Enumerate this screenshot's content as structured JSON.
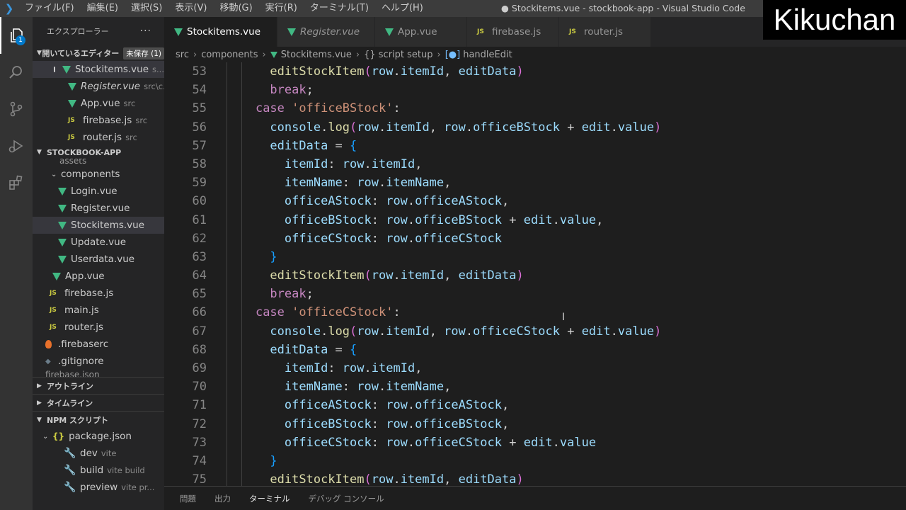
{
  "titlebar": {
    "menu": [
      "ファイル(F)",
      "編集(E)",
      "選択(S)",
      "表示(V)",
      "移動(G)",
      "実行(R)",
      "ターミナル(T)",
      "ヘルプ(H)"
    ],
    "window_title": "● Stockitems.vue - stockbook-app - Visual Studio Code",
    "watermark": "Kikuchan"
  },
  "activity": {
    "explorer_badge": "1"
  },
  "sidebar": {
    "title": "エクスプローラー",
    "more": "···",
    "open_editors": {
      "label": "開いているエディター",
      "unsaved": "未保存 (1)",
      "items": [
        {
          "name": "Stockitems.vue",
          "path": "s..."
        },
        {
          "name": "Register.vue",
          "path": "src\\c..."
        },
        {
          "name": "App.vue",
          "path": "src"
        },
        {
          "name": "firebase.js",
          "path": "src"
        },
        {
          "name": "router.js",
          "path": "src"
        }
      ]
    },
    "project": {
      "label": "STOCKBOOK-APP",
      "items": [
        "assets",
        "components",
        "Login.vue",
        "Register.vue",
        "Stockitems.vue",
        "Update.vue",
        "Userdata.vue",
        "App.vue",
        "firebase.js",
        "main.js",
        "router.js",
        ".firebaserc",
        ".gitignore",
        "firebase.json"
      ]
    },
    "outline": "アウトライン",
    "timeline": "タイムライン",
    "npm": {
      "label": "NPM スクリプト",
      "package": "package.json",
      "scripts": [
        {
          "name": "dev",
          "cmd": "vite"
        },
        {
          "name": "build",
          "cmd": "vite build"
        },
        {
          "name": "preview",
          "cmd": "vite pr..."
        }
      ]
    }
  },
  "tabs": [
    "Stockitems.vue",
    "Register.vue",
    "App.vue",
    "firebase.js",
    "router.js"
  ],
  "breadcrumb": [
    "src",
    "components",
    "Stockitems.vue",
    "{} script setup",
    "handleEdit"
  ],
  "editor": {
    "line_numbers": [
      "53",
      "54",
      "55",
      "56",
      "57",
      "58",
      "59",
      "60",
      "61",
      "62",
      "63",
      "64",
      "65",
      "66",
      "67",
      "68",
      "69",
      "70",
      "71",
      "72",
      "73",
      "74",
      "75"
    ],
    "lines": {
      "l53": {
        "fn": "editStockItem",
        "a": "row",
        "b": "itemId",
        "c": "editData"
      },
      "l54": "break",
      "l55": {
        "kw": "case",
        "str": "'officeBStock'"
      },
      "l56": {
        "obj": "console",
        "fn": "log",
        "a": "row",
        "b": "itemId",
        "c": "row",
        "d": "officeBStock",
        "e": "edit",
        "f": "value"
      },
      "l57": {
        "v": "editData"
      },
      "l58": {
        "k": "itemId",
        "o": "row",
        "p": "itemId"
      },
      "l59": {
        "k": "itemName",
        "o": "row",
        "p": "itemName"
      },
      "l60": {
        "k": "officeAStock",
        "o": "row",
        "p": "officeAStock"
      },
      "l61": {
        "k": "officeBStock",
        "o": "row",
        "p": "officeBStock",
        "e": "edit",
        "f": "value"
      },
      "l62": {
        "k": "officeCStock",
        "o": "row",
        "p": "officeCStock"
      },
      "l64": {
        "fn": "editStockItem",
        "a": "row",
        "b": "itemId",
        "c": "editData"
      },
      "l65": "break",
      "l66": {
        "kw": "case",
        "str": "'officeCStock'"
      },
      "l67": {
        "obj": "console",
        "fn": "log",
        "a": "row",
        "b": "itemId",
        "c": "row",
        "d": "officeCStock",
        "e": "edit",
        "f": "value"
      },
      "l68": {
        "v": "editData"
      },
      "l69": {
        "k": "itemId",
        "o": "row",
        "p": "itemId"
      },
      "l70": {
        "k": "itemName",
        "o": "row",
        "p": "itemName"
      },
      "l71": {
        "k": "officeAStock",
        "o": "row",
        "p": "officeAStock"
      },
      "l72": {
        "k": "officeBStock",
        "o": "row",
        "p": "officeBStock"
      },
      "l73": {
        "k": "officeCStock",
        "o": "row",
        "p": "officeCStock",
        "e": "edit",
        "f": "value"
      },
      "l75": {
        "fn": "editStockItem",
        "a": "row",
        "b": "itemId",
        "c": "editData"
      }
    }
  },
  "panel": {
    "tabs": [
      "問題",
      "出力",
      "ターミナル",
      "デバッグ コンソール"
    ]
  },
  "colors": {
    "accent": "#007acc",
    "vue_green": "#41b883",
    "js_yellow": "#cbcb41",
    "keyword": "#c586c0",
    "function": "#dcdcaa",
    "string": "#ce9178",
    "variable": "#9cdcfe"
  }
}
